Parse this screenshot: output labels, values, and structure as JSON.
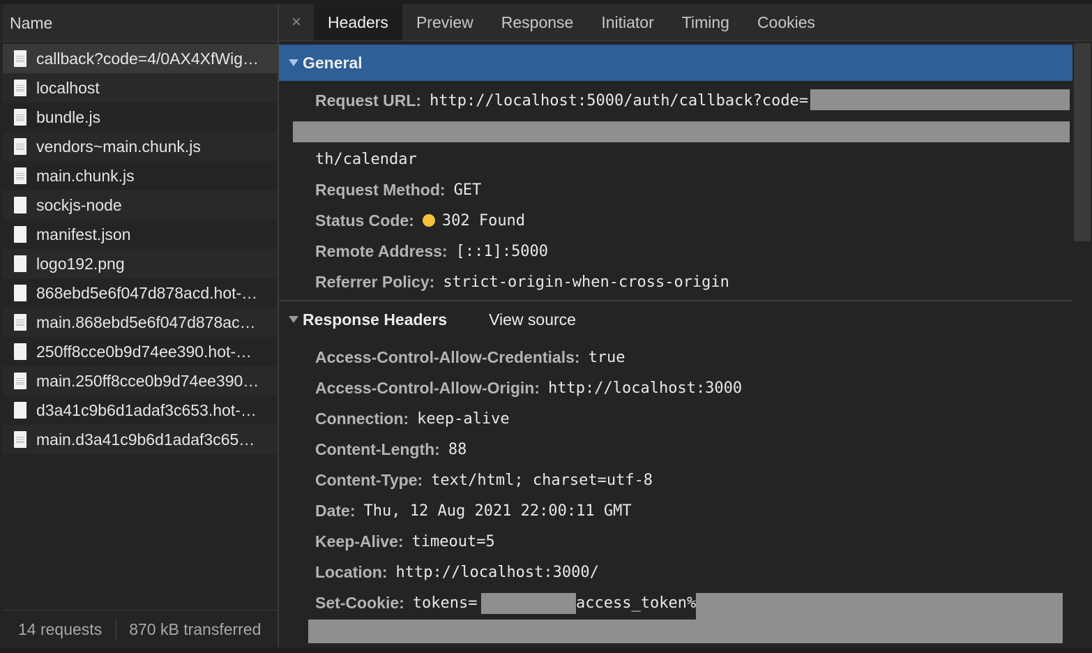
{
  "left_panel": {
    "column_header": "Name",
    "files": [
      {
        "name": "callback?code=4/0AX4XfWig…",
        "icon": "document-icon"
      },
      {
        "name": "localhost",
        "icon": "document-icon"
      },
      {
        "name": "bundle.js",
        "icon": "document-icon"
      },
      {
        "name": "vendors~main.chunk.js",
        "icon": "document-icon"
      },
      {
        "name": "main.chunk.js",
        "icon": "document-icon"
      },
      {
        "name": "sockjs-node",
        "icon": "blank-file-icon"
      },
      {
        "name": "manifest.json",
        "icon": "blank-file-icon"
      },
      {
        "name": "logo192.png",
        "icon": "blank-file-icon"
      },
      {
        "name": "868ebd5e6f047d878acd.hot-…",
        "icon": "blank-file-icon"
      },
      {
        "name": "main.868ebd5e6f047d878ac…",
        "icon": "document-icon"
      },
      {
        "name": "250ff8cce0b9d74ee390.hot-…",
        "icon": "blank-file-icon"
      },
      {
        "name": "main.250ff8cce0b9d74ee390…",
        "icon": "document-icon"
      },
      {
        "name": "d3a41c9b6d1adaf3c653.hot-…",
        "icon": "blank-file-icon"
      },
      {
        "name": "main.d3a41c9b6d1adaf3c65…",
        "icon": "document-icon"
      }
    ],
    "status": {
      "requests": "14 requests",
      "transferred": "870 kB transferred"
    }
  },
  "tabs": {
    "close_symbol": "×",
    "items": [
      "Headers",
      "Preview",
      "Response",
      "Initiator",
      "Timing",
      "Cookies"
    ],
    "active": "Headers"
  },
  "general": {
    "title": "General",
    "request_url_label": "Request URL:",
    "request_url_value": "http://localhost:5000/auth/callback?code=",
    "request_url_tail": "th/calendar",
    "request_method_label": "Request Method:",
    "request_method_value": "GET",
    "status_code_label": "Status Code:",
    "status_code_value": "302 Found",
    "status_color": "#f5c13b",
    "remote_address_label": "Remote Address:",
    "remote_address_value": "[::1]:5000",
    "referrer_policy_label": "Referrer Policy:",
    "referrer_policy_value": "strict-origin-when-cross-origin"
  },
  "response_headers": {
    "title": "Response Headers",
    "view_source": "View source",
    "items": [
      {
        "label": "Access-Control-Allow-Credentials:",
        "value": "true"
      },
      {
        "label": "Access-Control-Allow-Origin:",
        "value": "http://localhost:3000"
      },
      {
        "label": "Connection:",
        "value": "keep-alive"
      },
      {
        "label": "Content-Length:",
        "value": "88"
      },
      {
        "label": "Content-Type:",
        "value": "text/html; charset=utf-8"
      },
      {
        "label": "Date:",
        "value": "Thu, 12 Aug 2021 22:00:11 GMT"
      },
      {
        "label": "Keep-Alive:",
        "value": "timeout=5"
      },
      {
        "label": "Location:",
        "value": "http://localhost:3000/"
      }
    ],
    "set_cookie_label": "Set-Cookie:",
    "set_cookie_prefix": "tokens=",
    "set_cookie_mid": "access_token%"
  },
  "colors": {
    "section_blue": "#2e5f96",
    "redaction_grey": "#8f8f8f"
  }
}
